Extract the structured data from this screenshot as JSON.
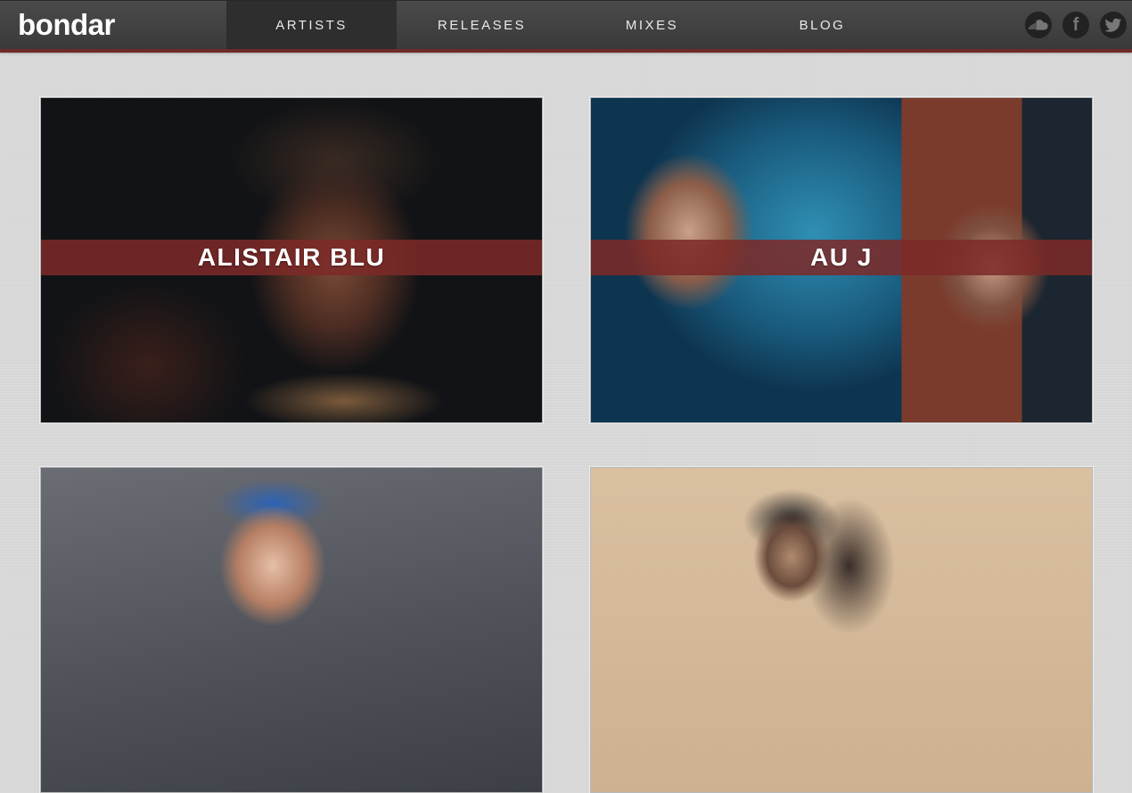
{
  "header": {
    "logo": "bondar",
    "nav": [
      {
        "label": "ARTISTS",
        "active": true
      },
      {
        "label": "RELEASES",
        "active": false
      },
      {
        "label": "MIXES",
        "active": false
      },
      {
        "label": "BLOG",
        "active": false
      }
    ],
    "social": [
      {
        "icon": "soundcloud-icon"
      },
      {
        "icon": "facebook-icon",
        "glyph": "f"
      },
      {
        "icon": "twitter-icon"
      }
    ],
    "accent_color": "#6e2b2a"
  },
  "artists": [
    {
      "name": "ALISTAIR BLU"
    },
    {
      "name": "AU J"
    },
    {
      "name": ""
    },
    {
      "name": ""
    }
  ]
}
